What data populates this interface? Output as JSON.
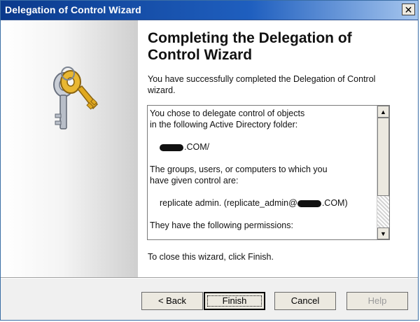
{
  "window": {
    "title": "Delegation of Control Wizard",
    "close_glyph": "✕"
  },
  "content": {
    "heading": "Completing the Delegation of Control Wizard",
    "intro": "You have successfully completed the Delegation of Control wizard.",
    "summary": {
      "line1": "You chose to delegate control of objects",
      "line2": "in the following Active Directory folder:",
      "folder_suffix": ".COM/",
      "line3": "The groups, users, or computers to which you",
      "line4": "have given control are:",
      "principal_prefix": "replicate admin. (replicate_admin@",
      "principal_suffix": ".COM)",
      "line5": "They have the following permissions:"
    },
    "closing": "To close this wizard, click Finish."
  },
  "buttons": {
    "back": "< Back",
    "finish": "Finish",
    "cancel": "Cancel",
    "help": "Help"
  },
  "icons": {
    "wizard_icon": "keys-icon",
    "scroll_up": "▲",
    "scroll_down": "▼"
  }
}
